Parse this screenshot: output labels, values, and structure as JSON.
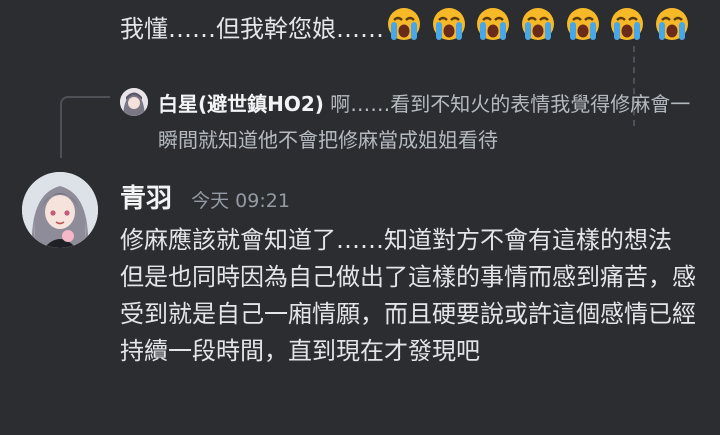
{
  "previous_message": {
    "text": "我懂……但我幹您娘……",
    "emojis": [
      "loudly-crying-face",
      "loudly-crying-face",
      "loudly-crying-face",
      "loudly-crying-face",
      "loudly-crying-face",
      "loudly-crying-face",
      "loudly-crying-face"
    ]
  },
  "reply_preview": {
    "author": "白星(避世鎮HO2)",
    "text": "啊……看到不知火的表情我覺得修麻會一瞬間就知道他不會把修麻當成姐姐看待"
  },
  "message": {
    "author": "青羽",
    "timestamp": "今天 09:21",
    "paragraphs": [
      "修麻應該就會知道了……知道對方不會有這樣的想法",
      "但是也同時因為自己做出了這樣的事情而感到痛苦，感受到就是自己一廂情願，而且硬要說或許這個感情已經持續一段時間，直到現在才發現吧"
    ]
  },
  "colors": {
    "background": "#2b2d31",
    "text": "#e3e5e8",
    "muted": "#949ba4",
    "reply_text": "#b5bac1"
  }
}
